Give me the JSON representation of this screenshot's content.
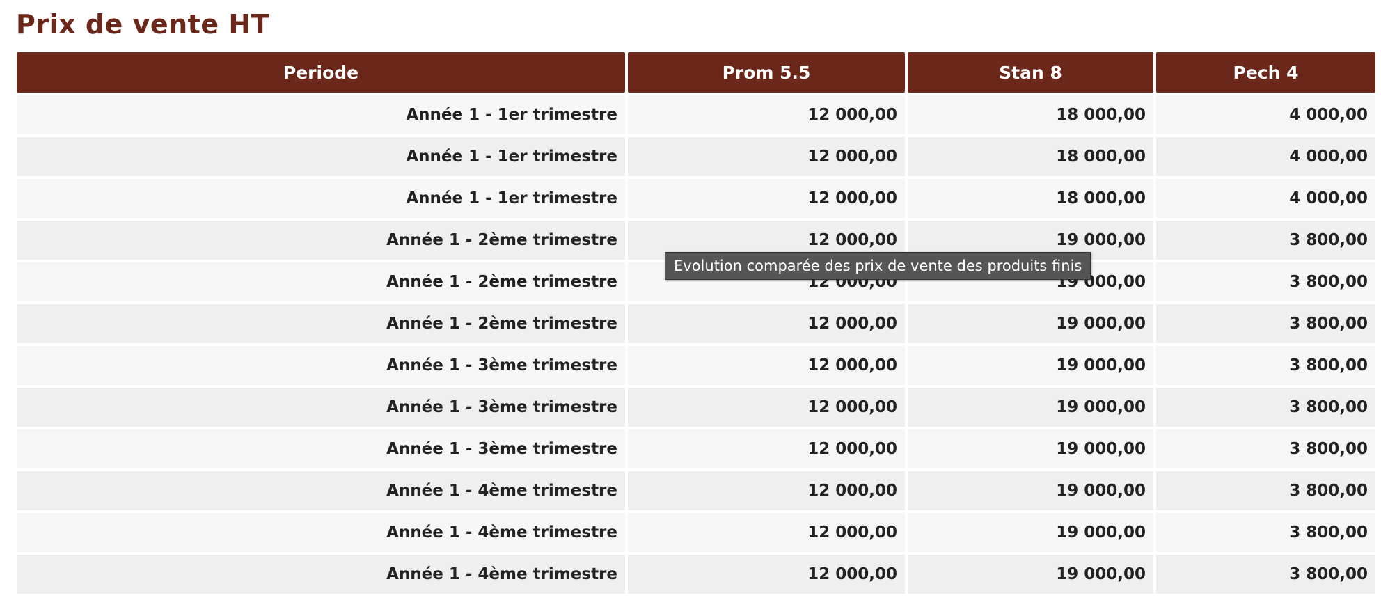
{
  "title": "Prix de vente HT",
  "table": {
    "columns": [
      "Periode",
      "Prom 5.5",
      "Stan 8",
      "Pech 4"
    ],
    "rows": [
      [
        "Année 1 - 1er trimestre",
        "12 000,00",
        "18 000,00",
        "4 000,00"
      ],
      [
        "Année 1 - 1er trimestre",
        "12 000,00",
        "18 000,00",
        "4 000,00"
      ],
      [
        "Année 1 - 1er trimestre",
        "12 000,00",
        "18 000,00",
        "4 000,00"
      ],
      [
        "Année 1 - 2ème trimestre",
        "12 000,00",
        "19 000,00",
        "3 800,00"
      ],
      [
        "Année 1 - 2ème trimestre",
        "12 000,00",
        "19 000,00",
        "3 800,00"
      ],
      [
        "Année 1 - 2ème trimestre",
        "12 000,00",
        "19 000,00",
        "3 800,00"
      ],
      [
        "Année 1 - 3ème trimestre",
        "12 000,00",
        "19 000,00",
        "3 800,00"
      ],
      [
        "Année 1 - 3ème trimestre",
        "12 000,00",
        "19 000,00",
        "3 800,00"
      ],
      [
        "Année 1 - 3ème trimestre",
        "12 000,00",
        "19 000,00",
        "3 800,00"
      ],
      [
        "Année 1 - 4ème trimestre",
        "12 000,00",
        "19 000,00",
        "3 800,00"
      ],
      [
        "Année 1 - 4ème trimestre",
        "12 000,00",
        "19 000,00",
        "3 800,00"
      ],
      [
        "Année 1 - 4ème trimestre",
        "12 000,00",
        "19 000,00",
        "3 800,00"
      ]
    ]
  },
  "tooltip": "Evolution comparée des prix de vente des produits finis",
  "colors": {
    "header_bg": "#6b2719",
    "title": "#6b2719",
    "row_odd": "#f6f6f6",
    "row_even": "#efefef",
    "tooltip_bg": "#555555"
  }
}
